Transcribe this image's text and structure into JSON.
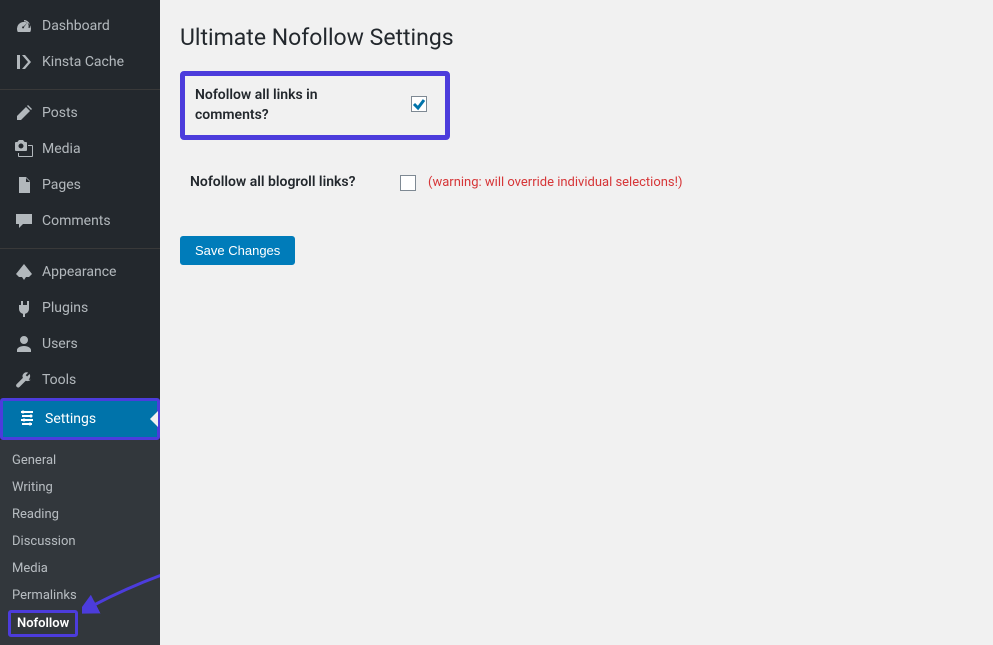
{
  "sidebar": {
    "items": [
      {
        "label": "Dashboard",
        "icon": "dashboard-icon"
      },
      {
        "label": "Kinsta Cache",
        "icon": "kinsta-icon"
      },
      {
        "label": "Posts",
        "icon": "posts-icon"
      },
      {
        "label": "Media",
        "icon": "media-icon"
      },
      {
        "label": "Pages",
        "icon": "pages-icon"
      },
      {
        "label": "Comments",
        "icon": "comments-icon"
      },
      {
        "label": "Appearance",
        "icon": "appearance-icon"
      },
      {
        "label": "Plugins",
        "icon": "plugins-icon"
      },
      {
        "label": "Users",
        "icon": "users-icon"
      },
      {
        "label": "Tools",
        "icon": "tools-icon"
      },
      {
        "label": "Settings",
        "icon": "settings-icon"
      }
    ],
    "submenu": [
      {
        "label": "General"
      },
      {
        "label": "Writing"
      },
      {
        "label": "Reading"
      },
      {
        "label": "Discussion"
      },
      {
        "label": "Media"
      },
      {
        "label": "Permalinks"
      },
      {
        "label": "Nofollow"
      }
    ]
  },
  "main": {
    "title": "Ultimate Nofollow Settings",
    "row1_label": "Nofollow all links in comments?",
    "row2_label": "Nofollow all blogroll links?",
    "warning_text": "(warning: will override individual selections!)",
    "save_label": "Save Changes"
  }
}
